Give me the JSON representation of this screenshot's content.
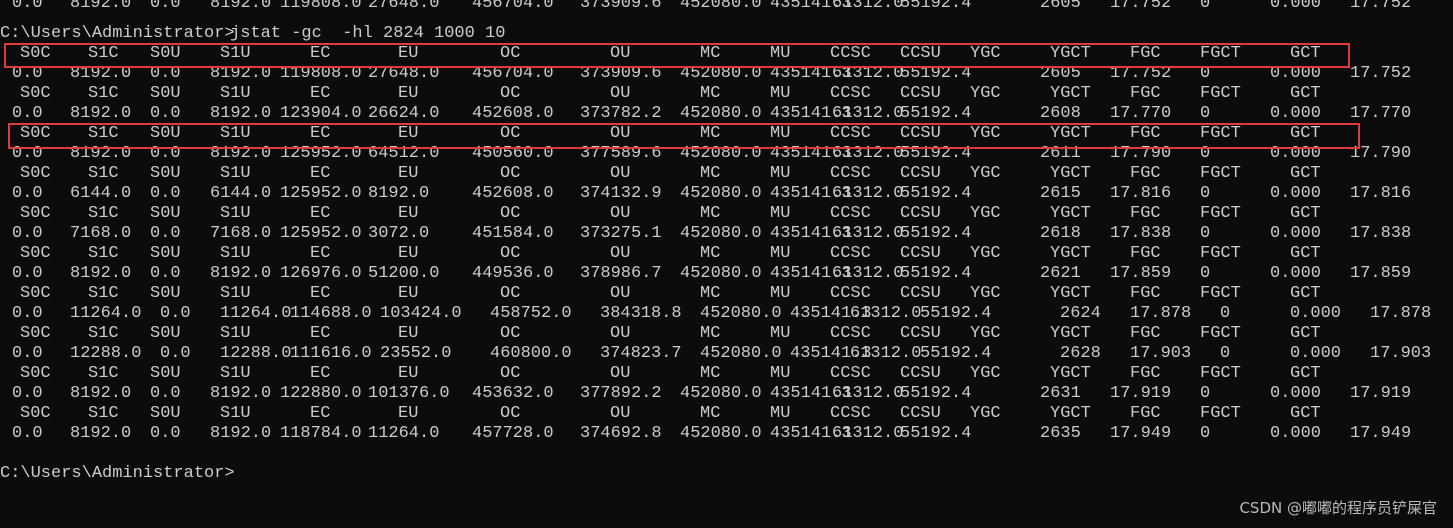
{
  "terminal": {
    "prompt_path": "C:\\Users\\Administrator>",
    "command": "jstat -gc  -hl 2824 1000 10",
    "top_partial_row": [
      "0.0",
      "8192.0",
      "0.0",
      "8192.0",
      "119808.0",
      "27648.0",
      "456704.0",
      "373909.6",
      "452080.0",
      "435141.3",
      "61312.0",
      "55192.4",
      "2605",
      "17.752",
      "0",
      "0.000",
      "17.752"
    ],
    "headers": [
      "S0C",
      "S1C",
      "S0U",
      "S1U",
      "EC",
      "EU",
      "OC",
      "OU",
      "MC",
      "MU",
      "CCSC",
      "CCSU",
      "YGC",
      "YGCT",
      "FGC",
      "FGCT",
      "GCT"
    ],
    "rows": [
      [
        "0.0",
        "8192.0",
        "0.0",
        "8192.0",
        "119808.0",
        "27648.0",
        "456704.0",
        "373909.6",
        "452080.0",
        "435141.3",
        "61312.0",
        "55192.4",
        "2605",
        "17.752",
        "0",
        "0.000",
        "17.752"
      ],
      [
        "0.0",
        "8192.0",
        "0.0",
        "8192.0",
        "123904.0",
        "26624.0",
        "452608.0",
        "373782.2",
        "452080.0",
        "435141.3",
        "61312.0",
        "55192.4",
        "2608",
        "17.770",
        "0",
        "0.000",
        "17.770"
      ],
      [
        "0.0",
        "8192.0",
        "0.0",
        "8192.0",
        "125952.0",
        "64512.0",
        "450560.0",
        "377589.6",
        "452080.0",
        "435141.3",
        "61312.0",
        "55192.4",
        "2611",
        "17.790",
        "0",
        "0.000",
        "17.790"
      ],
      [
        "0.0",
        "6144.0",
        "0.0",
        "6144.0",
        "125952.0",
        "8192.0",
        "452608.0",
        "374132.9",
        "452080.0",
        "435141.3",
        "61312.0",
        "55192.4",
        "2615",
        "17.816",
        "0",
        "0.000",
        "17.816"
      ],
      [
        "0.0",
        "7168.0",
        "0.0",
        "7168.0",
        "125952.0",
        "3072.0",
        "451584.0",
        "373275.1",
        "452080.0",
        "435141.3",
        "61312.0",
        "55192.4",
        "2618",
        "17.838",
        "0",
        "0.000",
        "17.838"
      ],
      [
        "0.0",
        "8192.0",
        "0.0",
        "8192.0",
        "126976.0",
        "51200.0",
        "449536.0",
        "378986.7",
        "452080.0",
        "435141.3",
        "61312.0",
        "55192.4",
        "2621",
        "17.859",
        "0",
        "0.000",
        "17.859"
      ],
      [
        "0.0",
        "11264.0",
        "0.0",
        "11264.0",
        "114688.0",
        "103424.0",
        "458752.0",
        "384318.8",
        "452080.0",
        "435141.3",
        "61312.0",
        "55192.4",
        "2624",
        "17.878",
        "0",
        "0.000",
        "17.878"
      ],
      [
        "0.0",
        "12288.0",
        "0.0",
        "12288.0",
        "111616.0",
        "23552.0",
        "460800.0",
        "374823.7",
        "452080.0",
        "435141.3",
        "61312.0",
        "55192.4",
        "2628",
        "17.903",
        "0",
        "0.000",
        "17.903"
      ],
      [
        "0.0",
        "8192.0",
        "0.0",
        "8192.0",
        "122880.0",
        "101376.0",
        "453632.0",
        "377892.2",
        "452080.0",
        "435141.3",
        "61312.0",
        "55192.4",
        "2631",
        "17.919",
        "0",
        "0.000",
        "17.919"
      ],
      [
        "0.0",
        "8192.0",
        "0.0",
        "8192.0",
        "118784.0",
        "11264.0",
        "457728.0",
        "374692.8",
        "452080.0",
        "435141.3",
        "61312.0",
        "55192.4",
        "2635",
        "17.949",
        "0",
        "0.000",
        "17.949"
      ]
    ],
    "final_prompt": "C:\\Users\\Administrator>",
    "highlight_color": "#e03a3a",
    "text_color": "#cccccc",
    "background_color": "#0c0c0c"
  },
  "watermark": "CSDN @嘟嘟的程序员铲屎官"
}
